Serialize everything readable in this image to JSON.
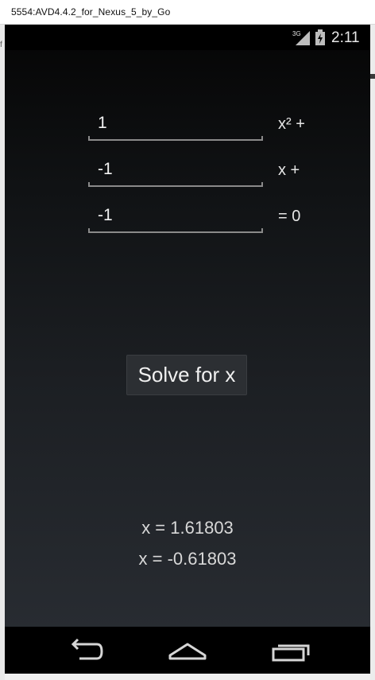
{
  "window": {
    "title": "5554:AVD4.4.2_for_Nexus_5_by_Go",
    "left_glyph": "f"
  },
  "status_bar": {
    "network": "3G",
    "time": "2:11",
    "icons": [
      "signal-icon",
      "battery-icon"
    ]
  },
  "equation": {
    "rows": [
      {
        "value": "1",
        "term": "x² +"
      },
      {
        "value": "-1",
        "term": "x +"
      },
      {
        "value": "-1",
        "term": "= 0"
      }
    ]
  },
  "solve_button": {
    "label": "Solve for x"
  },
  "results": [
    "x = 1.61803",
    "x = -0.61803"
  ],
  "nav": {
    "icons": [
      "back-icon",
      "home-icon",
      "recent-apps-icon"
    ]
  },
  "colors": {
    "screen_top": "#050505",
    "screen_bottom": "#2a2e34",
    "text": "#e6e6e6"
  }
}
